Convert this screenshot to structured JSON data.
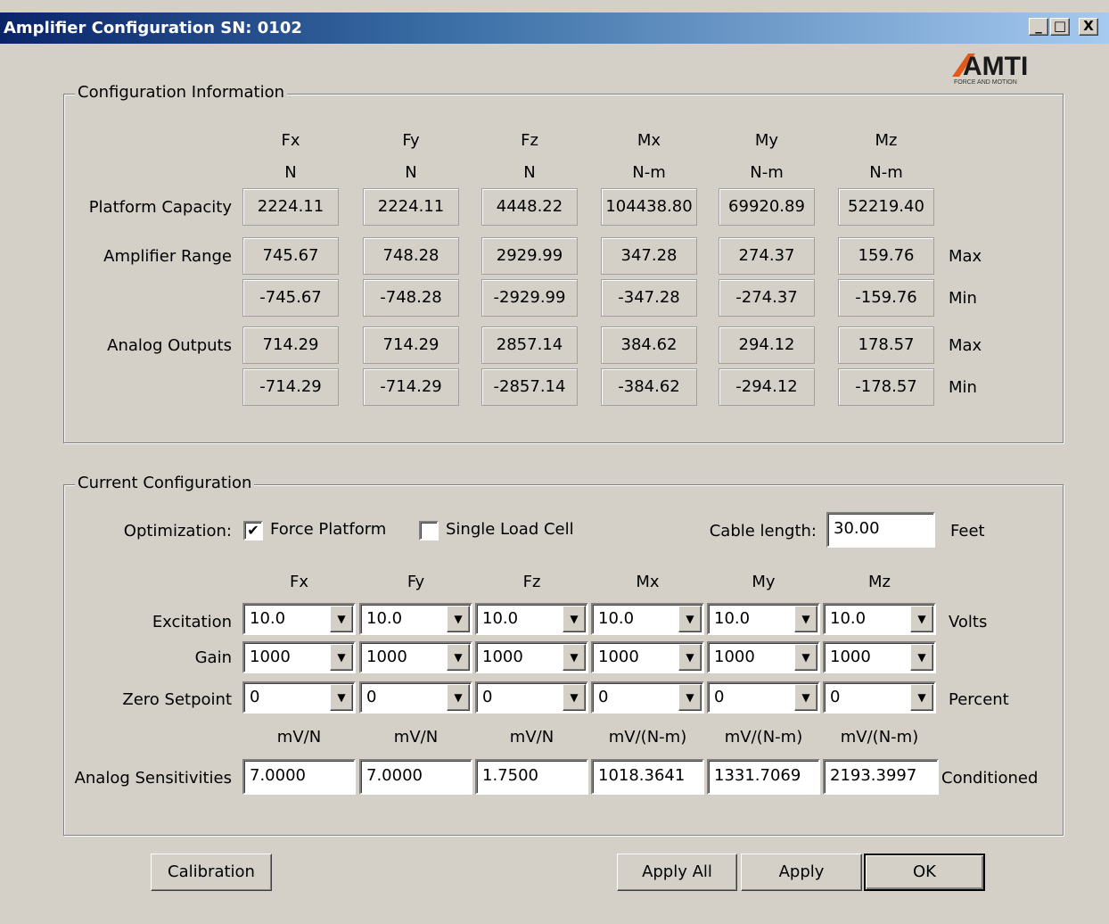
{
  "window": {
    "title": "Amplifier Configuration SN: 0102",
    "minimize_glyph": "_",
    "maximize_glyph": "□",
    "close_glyph": "X"
  },
  "logo": {
    "text": "AMTI",
    "tagline": "FORCE AND MOTION",
    "brand_color": "#e05a1a"
  },
  "config_info": {
    "title": "Configuration Information",
    "columns": [
      "Fx",
      "Fy",
      "Fz",
      "Mx",
      "My",
      "Mz"
    ],
    "units": [
      "N",
      "N",
      "N",
      "N-m",
      "N-m",
      "N-m"
    ],
    "rows": {
      "platform_capacity": {
        "label": "Platform Capacity",
        "values": [
          "2224.11",
          "2224.11",
          "4448.22",
          "104438.80",
          "69920.89",
          "52219.40"
        ]
      },
      "amp_range_max": {
        "label": "Amplifier Range",
        "suffix": "Max",
        "values": [
          "745.67",
          "748.28",
          "2929.99",
          "347.28",
          "274.37",
          "159.76"
        ]
      },
      "amp_range_min": {
        "suffix": "Min",
        "values": [
          "-745.67",
          "-748.28",
          "-2929.99",
          "-347.28",
          "-274.37",
          "-159.76"
        ]
      },
      "analog_out_max": {
        "label": "Analog Outputs",
        "suffix": "Max",
        "values": [
          "714.29",
          "714.29",
          "2857.14",
          "384.62",
          "294.12",
          "178.57"
        ]
      },
      "analog_out_min": {
        "suffix": "Min",
        "values": [
          "-714.29",
          "-714.29",
          "-2857.14",
          "-384.62",
          "-294.12",
          "-178.57"
        ]
      }
    }
  },
  "current_config": {
    "title": "Current Configuration",
    "optimization_label": "Optimization:",
    "force_platform": {
      "label": "Force Platform",
      "checked": true,
      "mark": "✔"
    },
    "single_load_cell": {
      "label": "Single Load Cell",
      "checked": false,
      "mark": ""
    },
    "cable_length": {
      "label": "Cable length:",
      "value": "30.00",
      "unit": "Feet"
    },
    "columns": [
      "Fx",
      "Fy",
      "Fz",
      "Mx",
      "My",
      "Mz"
    ],
    "excitation": {
      "label": "Excitation",
      "values": [
        "10.0",
        "10.0",
        "10.0",
        "10.0",
        "10.0",
        "10.0"
      ],
      "unit": "Volts"
    },
    "gain": {
      "label": "Gain",
      "values": [
        "1000",
        "1000",
        "1000",
        "1000",
        "1000",
        "1000"
      ]
    },
    "zero_setpoint": {
      "label": "Zero Setpoint",
      "values": [
        "0",
        "0",
        "0",
        "0",
        "0",
        "0"
      ],
      "unit": "Percent"
    },
    "sensitivity_units": [
      "mV/N",
      "mV/N",
      "mV/N",
      "mV/(N-m)",
      "mV/(N-m)",
      "mV/(N-m)"
    ],
    "analog_sensitivities": {
      "label": "Analog Sensitivities",
      "values": [
        "7.0000",
        "7.0000",
        "1.7500",
        "1018.3641",
        "1331.7069",
        "2193.3997"
      ],
      "suffix": "Conditioned"
    },
    "dropdown_arrow": "▼"
  },
  "buttons": {
    "calibration": "Calibration",
    "apply_all": "Apply All",
    "apply": "Apply",
    "ok": "OK"
  }
}
